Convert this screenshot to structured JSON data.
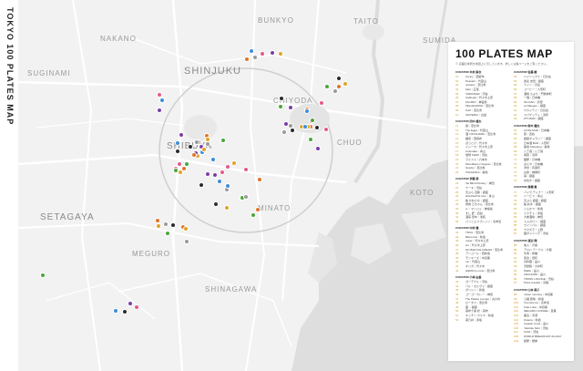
{
  "spine_title": "TOKYO 100 PLATES MAP",
  "districts": [
    {
      "name": "BUNKYO",
      "cls": "d-bunkyo"
    },
    {
      "name": "TAITO",
      "cls": "d-taito"
    },
    {
      "name": "NAKANO",
      "cls": "d-nakano"
    },
    {
      "name": "SUMIDA",
      "cls": "d-sumida"
    },
    {
      "name": "SUGINAMI",
      "cls": "d-suginami"
    },
    {
      "name": "SHINJUKU",
      "cls": "d-shinjuku"
    },
    {
      "name": "CHIYODA",
      "cls": "d-chiyoda"
    },
    {
      "name": "SHIBUYA",
      "cls": "d-shibuya"
    },
    {
      "name": "CHUO",
      "cls": "d-chuo"
    },
    {
      "name": "SETAGAYA",
      "cls": "d-setagaya"
    },
    {
      "name": "MINATO",
      "cls": "d-minato"
    },
    {
      "name": "KOTO",
      "cls": "d-koto"
    },
    {
      "name": "MEGURO",
      "cls": "d-meguro"
    },
    {
      "name": "SHINAGAWA",
      "cls": "d-shinagawa"
    }
  ],
  "panel": {
    "title": "100 PLATES MAP",
    "subtitle": "※ 店舗の場所を地図上に示しています。詳しくは各ページをご覧ください。",
    "columns": [
      {
        "cls": "c1",
        "groups": [
          {
            "label": "CURATOR 木村 麻衣",
            "entries": [
              {
                "n": "01",
                "t": "Conny｜西麻布"
              },
              {
                "n": "02",
                "t": "Peasant｜代官山"
              },
              {
                "n": "03",
                "t": "uriosiso｜恵比寿"
              },
              {
                "n": "04",
                "t": "bakt｜広尾"
              },
              {
                "n": "05",
                "t": "VIRONSAR｜渋谷"
              },
              {
                "n": "06",
                "t": "Cabriolet｜代々木上原"
              },
              {
                "n": "07",
                "t": "FACIMO｜神宮前"
              },
              {
                "n": "08",
                "t": "PELLEGRINO｜恵比寿"
              },
              {
                "n": "09",
                "t": "CAZ｜恵比寿"
              },
              {
                "n": "10",
                "t": "ISOTERIA｜白金"
              }
            ]
          },
          {
            "label": "CURATOR 田中 雄太",
            "entries": [
              {
                "n": "11",
                "t": "蕎｜恵比寿"
              },
              {
                "n": "12",
                "t": "The Eggs｜代官山"
              },
              {
                "n": "13",
                "t": "酒 YOKOHAMA｜恵比寿"
              },
              {
                "n": "14",
                "t": "麺亭｜西麻布"
              },
              {
                "n": "15",
                "t": "ほっとけ｜代々木"
              },
              {
                "n": "16",
                "t": "ミシーカ｜代々木上原"
              },
              {
                "n": "17",
                "t": "Colonada｜青山"
              },
              {
                "n": "18",
                "t": "珈琲 KIRIN｜渋谷"
              },
              {
                "n": "19",
                "t": "ラミスト｜六本木"
              },
              {
                "n": "20",
                "t": "MoreRamen Seppan｜恵比寿"
              },
              {
                "n": "21",
                "t": "Gravity｜恵比寿"
              },
              {
                "n": "22",
                "t": "TAKAZAKA｜築地"
              }
            ]
          },
          {
            "label": "CURATOR 伊藤 萌",
            "entries": [
              {
                "n": "23",
                "t": "the Blind Donkey｜神田"
              },
              {
                "n": "24",
                "t": "ケーキ｜渋谷"
              },
              {
                "n": "25",
                "t": "天ぷら 近藤｜銀座"
              },
              {
                "n": "26",
                "t": "HIGASHIYA man｜青山"
              },
              {
                "n": "27",
                "t": "鮨 かねさか｜銀座"
              },
              {
                "n": "28",
                "t": "焼肉 乙ちゃん｜恵比寿"
              },
              {
                "n": "29",
                "t": "ル・マンジュ｜神楽坂"
              },
              {
                "n": "30",
                "t": "すし 匠｜四谷"
              },
              {
                "n": "31",
                "t": "酒亭 田中｜池尻"
              },
              {
                "n": "32",
                "t": "パンとエスプレッソ｜表参道"
              }
            ]
          },
          {
            "label": "CURATOR 中村 健",
            "entries": [
              {
                "n": "33",
                "t": "TRUA｜恵比寿"
              },
              {
                "n": "34",
                "t": "Bistro Kai｜新宿"
              },
              {
                "n": "35",
                "t": "rosier｜代々木上原"
              },
              {
                "n": "36",
                "t": "sio｜代々木上原"
              },
              {
                "n": "37",
                "t": "NO BAR ICE CREAM｜恵比寿"
              },
              {
                "n": "38",
                "t": "アンコール｜西新宿"
              },
              {
                "n": "39",
                "t": "モンキーズ｜中目黒"
              },
              {
                "n": "40",
                "t": "mu｜代官山"
              },
              {
                "n": "41",
                "t": "オリガ｜代々木"
              },
              {
                "n": "42",
                "t": "GEMS by moto｜恵比寿"
              }
            ]
          },
          {
            "label": "CURATOR 小林 由香",
            "entries": [
              {
                "n": "43",
                "t": "ガーデナル｜渋谷"
              },
              {
                "n": "44",
                "t": "バル・セルヴァ｜銀座"
              },
              {
                "n": "45",
                "t": "ダンシン｜新宿"
              },
              {
                "n": "46",
                "t": "ゴーゴーカレー｜神田"
              },
              {
                "n": "47",
                "t": "The Palace Lounge｜丸の内"
              },
              {
                "n": "48",
                "t": "ロータス｜恵比寿"
              },
              {
                "n": "49",
                "t": "茜 ｜銀座"
              },
              {
                "n": "50",
                "t": "麻布十番 松｜麻布"
              },
              {
                "n": "51",
                "t": "キッチン カミヤ｜新宿"
              },
              {
                "n": "52",
                "t": "菊乃井｜赤坂"
              }
            ]
          }
        ]
      },
      {
        "cls": "c2",
        "groups": [
          {
            "label": "CURATOR 佐藤 綾",
            "entries": [
              {
                "n": "53",
                "t": "ハイソックス｜日比谷"
              },
              {
                "n": "54",
                "t": "蕎麦 吉田｜銀座"
              },
              {
                "n": "55",
                "t": "ナイン｜月島"
              },
              {
                "n": "56",
                "t": "コーヒー｜人形町"
              },
              {
                "n": "57",
                "t": "酒場 さより｜門前仲町"
              },
              {
                "n": "58",
                "t": "一銭｜日本橋"
              },
              {
                "n": "59",
                "t": "OK-DAN｜清澄"
              },
              {
                "n": "60",
                "t": "La Maugen｜銀座"
              },
              {
                "n": "61",
                "t": "ウカイテイ｜日比谷"
              },
              {
                "n": "62",
                "t": "スパゲッティ｜浅草"
              },
              {
                "n": "63",
                "t": "ZTT-BAR｜銀座"
              }
            ]
          },
          {
            "label": "CURATOR 鈴木 健太",
            "entries": [
              {
                "n": "64",
                "t": "COTE DOR｜日本橋"
              },
              {
                "n": "65",
                "t": "鶏｜四谷"
              },
              {
                "n": "66",
                "t": "銀座ギャラリー｜銀座"
              },
              {
                "n": "67",
                "t": "日本酒 BAR｜人形町"
              },
              {
                "n": "68",
                "t": "築地 Shopping｜築地"
              },
              {
                "n": "69",
                "t": "八丁堀｜八丁堀"
              },
              {
                "n": "70",
                "t": "喫茶｜浅草"
              },
              {
                "n": "71",
                "t": "麺屋｜日本橋"
              },
              {
                "n": "72",
                "t": "ばんや｜日本橋"
              },
              {
                "n": "73",
                "t": "洋食｜有楽町"
              },
              {
                "n": "74",
                "t": "丸香｜神保町"
              },
              {
                "n": "75",
                "t": "麻｜銀座"
              },
              {
                "n": "76",
                "t": "水炊き｜銀座"
              }
            ]
          },
          {
            "label": "CURATOR 高橋 恵",
            "entries": [
              {
                "n": "77",
                "t": "バイク ディナー｜人形町"
              },
              {
                "n": "78",
                "t": "ハービス｜青山"
              },
              {
                "n": "79",
                "t": "天ぷら 銀座｜銀座"
              },
              {
                "n": "80",
                "t": "鮨 鈴木｜銀座"
              },
              {
                "n": "81",
                "t": "とんかつ｜新宿"
              },
              {
                "n": "82",
                "t": "ミヤモト｜赤坂"
              },
              {
                "n": "83",
                "t": "大衆酒場｜神田"
              },
              {
                "n": "84",
                "t": "トムガパン｜銀座"
              },
              {
                "n": "85",
                "t": "ワインバル｜銀座"
              },
              {
                "n": "86",
                "t": "ウマズラ｜上野"
              },
              {
                "n": "87",
                "t": "麺ダイニング｜渋谷"
              }
            ]
          },
          {
            "label": "CURATOR 渡辺 翔",
            "entries": [
              {
                "n": "88",
                "t": "炭火｜汐留"
              },
              {
                "n": "89",
                "t": "アロハ テーブル｜汐留"
              },
              {
                "n": "90",
                "t": "牛肉｜新橋"
              },
              {
                "n": "91",
                "t": "菜食｜田町"
              },
              {
                "n": "92",
                "t": "鳥料理｜品川"
              },
              {
                "n": "93",
                "t": "天麩羅｜大井町"
              },
              {
                "n": "94",
                "t": "Wallis｜品川"
              },
              {
                "n": "95",
                "t": "ANCHORS｜品川"
              },
              {
                "n": "96",
                "t": "TRUNK LOUNGE｜渋谷"
              },
              {
                "n": "97",
                "t": "Pizza Cavallo｜高輪"
              }
            ]
          },
          {
            "label": "CURATOR 山本 陽子",
            "entries": [
              {
                "n": "98",
                "t": "mister morning｜中目黒"
              },
              {
                "n": "99",
                "t": "ら麺 鶏喰｜新宿"
              },
              {
                "n": "100",
                "t": "Two Rooms｜表参道"
              },
              {
                "n": "101",
                "t": "Cafe Lotta｜中目黒"
              },
              {
                "n": "102",
                "t": "MEGURO COFFEE｜目黒"
              },
              {
                "n": "103",
                "t": "鹿島｜清澄"
              },
              {
                "n": "104",
                "t": "Osteria｜新宿"
              },
              {
                "n": "105",
                "t": "Captain Cook｜品川"
              },
              {
                "n": "106",
                "t": "Yakiniku Mori｜渋谷"
              },
              {
                "n": "107",
                "t": "OASI｜渋谷"
              },
              {
                "n": "108",
                "t": "WORLD BREAKFAST ALLDAY"
              },
              {
                "n": "109",
                "t": "鍵屋｜根岸"
              }
            ]
          }
        ]
      }
    ]
  },
  "marker_colors": [
    "#e0a32a",
    "#3b8ed8",
    "#7a3fa6",
    "#e55a8a",
    "#2b2b2b",
    "#4aa63b",
    "#e0752a",
    "#9a9a9a"
  ]
}
